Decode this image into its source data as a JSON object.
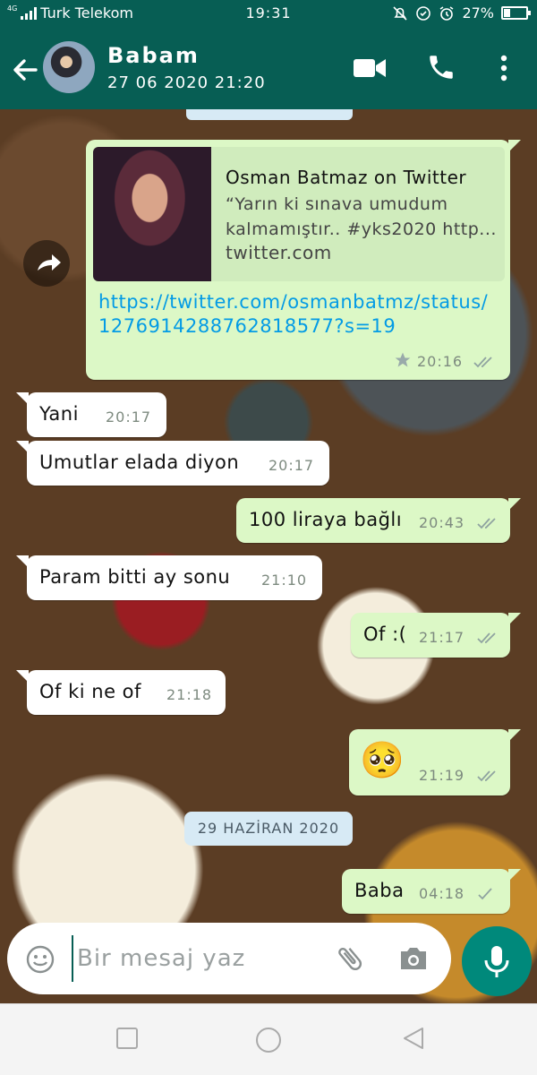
{
  "status_bar": {
    "network": "4G",
    "carrier": "Turk Telekom",
    "time": "19:31",
    "battery": "27%"
  },
  "header": {
    "contact_name": "Babam",
    "last_seen": "27 06 2020 21:20",
    "icons": [
      "back-arrow-icon",
      "video-call-icon",
      "phone-icon",
      "more-vert-icon"
    ]
  },
  "messages": [
    {
      "direction": "out",
      "link_preview": {
        "title": "Osman Batmaz on Twitter",
        "description": "“Yarın ki sınava umudum kalmamıştır.. #yks2020 http...",
        "domain": "twitter.com"
      },
      "text": "https://twitter.com/osmanbatmz/status/1276914288762818577?s=19",
      "time": "20:16",
      "starred": true,
      "status": "read"
    },
    {
      "direction": "in",
      "text": "Yani",
      "time": "20:17"
    },
    {
      "direction": "in",
      "text": "Umutlar elada diyon",
      "time": "20:17"
    },
    {
      "direction": "out",
      "text": "100 liraya bağlı",
      "time": "20:43",
      "status": "read"
    },
    {
      "direction": "in",
      "text": "Param bitti ay sonu",
      "time": "21:10"
    },
    {
      "direction": "out",
      "text": "Of :(",
      "time": "21:17",
      "status": "read"
    },
    {
      "direction": "in",
      "text": "Of ki ne of",
      "time": "21:18"
    },
    {
      "direction": "out",
      "emoji": "🥺",
      "time": "21:19",
      "status": "read"
    },
    {
      "direction": "out",
      "text": "Baba",
      "time": "04:18",
      "status": "sent"
    }
  ],
  "date_divider": "29 HAZİRAN 2020",
  "composer": {
    "placeholder": "Bir mesaj yaz",
    "icons": [
      "emoji-icon",
      "attach-icon",
      "camera-icon",
      "mic-icon"
    ]
  },
  "colors": {
    "header": "#075e54",
    "outgoing_bubble": "#dcf8c6",
    "incoming_bubble": "#ffffff",
    "link": "#039be5",
    "mic_button": "#00897b"
  }
}
